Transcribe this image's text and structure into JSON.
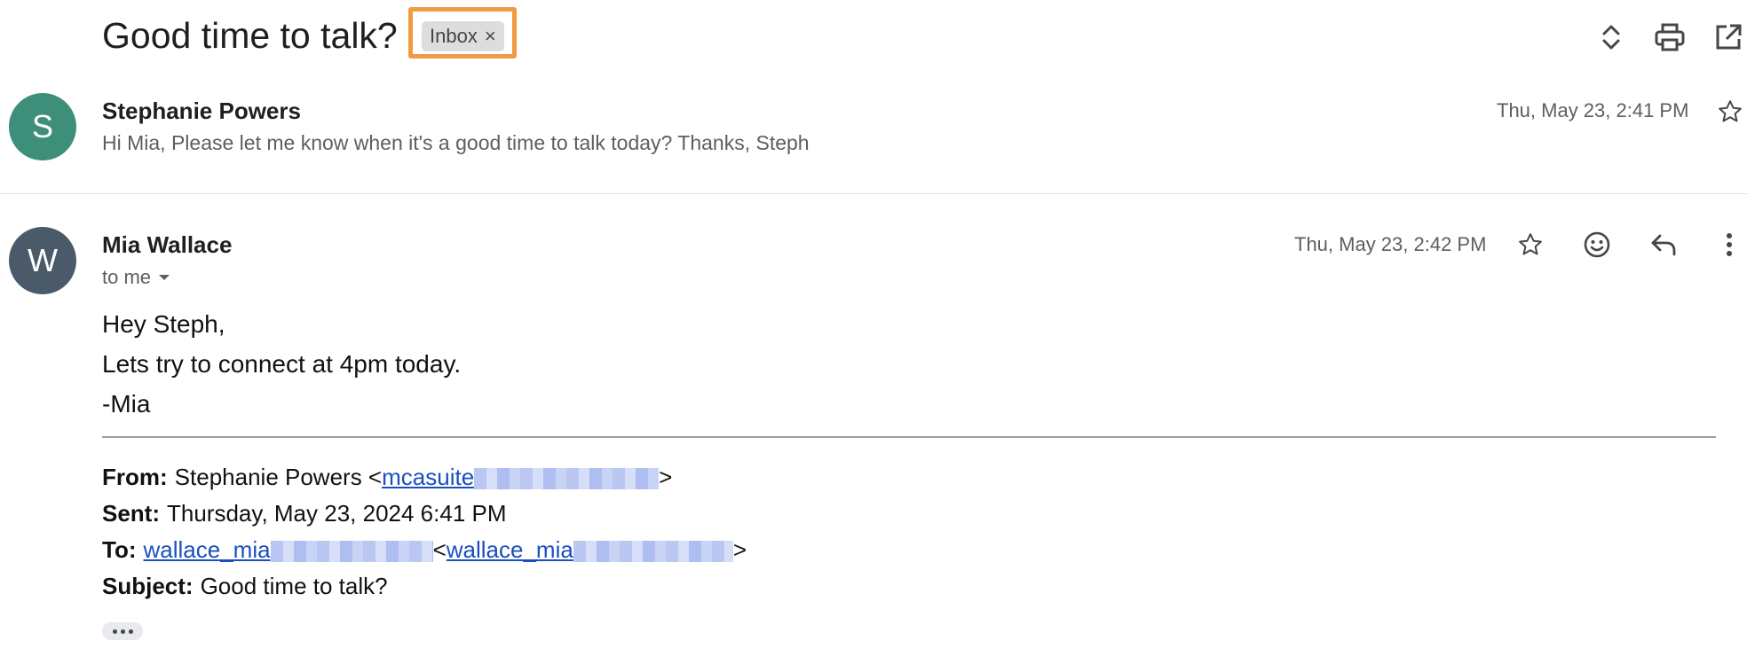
{
  "thread": {
    "subject": "Good time to talk?",
    "label": "Inbox",
    "label_remove": "×",
    "header_icons": [
      "expand-collapse-icon",
      "print-icon",
      "open-in-new-window-icon"
    ]
  },
  "messages": [
    {
      "avatar_letter": "S",
      "avatar_color": "#3d8f7a",
      "sender": "Stephanie Powers",
      "snippet": "Hi Mia, Please let me know when it's a good time to talk today? Thanks, Steph",
      "date": "Thu, May 23, 2:41 PM"
    },
    {
      "avatar_letter": "W",
      "avatar_color": "#4a5a68",
      "sender": "Mia Wallace",
      "recipients": "to me",
      "date": "Thu, May 23, 2:42 PM",
      "body": [
        "Hey Steph,",
        "Lets try to connect at 4pm today.",
        "-Mia"
      ],
      "quoted": {
        "from_label": "From:",
        "from_name": "Stephanie Powers <",
        "from_email": "mcasuite",
        "from_close": ">",
        "sent_label": "Sent:",
        "sent_value": "Thursday, May 23, 2024 6:41 PM",
        "to_label": "To:",
        "to_email": "wallace_mia",
        "to_open": "<",
        "to_email2": "wallace_mia",
        "to_close": ">",
        "subject_label": "Subject:",
        "subject_value": "Good time to talk?"
      }
    }
  ],
  "colors": {
    "highlight": "#f29a3f",
    "link": "#1a4fbf"
  }
}
